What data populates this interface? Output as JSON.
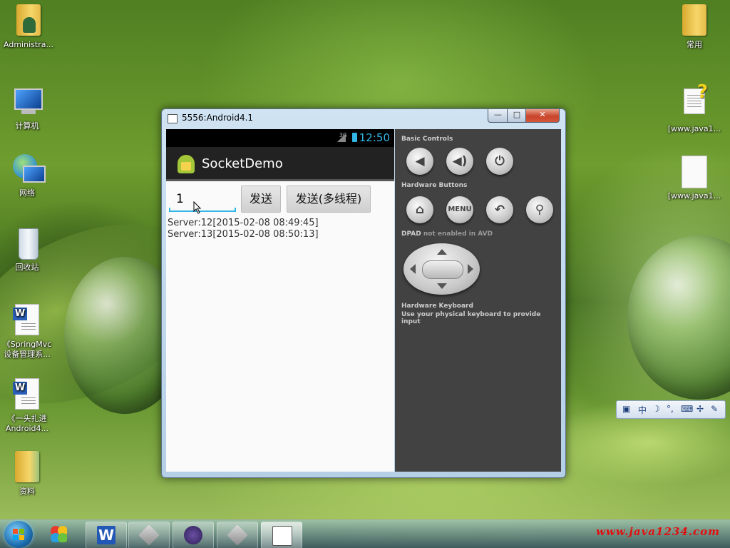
{
  "desktop": {
    "left_icons": [
      {
        "label": "Administra...",
        "icon": "user-folder-icon"
      },
      {
        "label": "计算机",
        "icon": "computer-icon"
      },
      {
        "label": "网络",
        "icon": "network-icon"
      },
      {
        "label": "回收站",
        "icon": "recycle-bin-icon"
      },
      {
        "label": "《SpringMvc\n设备管理系...",
        "icon": "word-document-icon"
      },
      {
        "label": "《一头扎进\nAndroid4...",
        "icon": "word-document-icon"
      },
      {
        "label": "资料",
        "icon": "folder-icon"
      }
    ],
    "right_icons": [
      {
        "label": "常用",
        "icon": "folder-icon"
      },
      {
        "label": "[www.java1...",
        "icon": "help-file-icon"
      },
      {
        "label": "[www.java1...",
        "icon": "blank-file-icon"
      }
    ]
  },
  "emulator": {
    "title": "5556:Android4.1",
    "window_buttons": {
      "minimize": "—",
      "maximize": "□",
      "close": "✕"
    },
    "statusbar": {
      "network": "3G",
      "clock": "12:50"
    },
    "app": {
      "title": "SocketDemo",
      "input_value": "1",
      "send_label": "发送",
      "send_multithread_label": "发送(多线程)",
      "messages": [
        "Server:12[2015-02-08 08:49:45]",
        "Server:13[2015-02-08 08:50:13]"
      ]
    },
    "controls": {
      "basic_controls_label": "Basic Controls",
      "hardware_buttons_label": "Hardware Buttons",
      "menu_label": "MENU",
      "dpad_label": "DPAD",
      "dpad_note": "not enabled in AVD",
      "keyboard_label": "Hardware Keyboard",
      "keyboard_note": "Use your physical keyboard to provide input"
    }
  },
  "ime_toolbar": {
    "lang": "中"
  },
  "taskbar": {
    "items": [
      "start-orb",
      "pinwheel-app",
      "wps-writer",
      "android-emulator",
      "java-ee-ide",
      "emulator-window",
      "notepad"
    ]
  },
  "watermark": "www.java1234.com",
  "colors": {
    "accent_holo": "#33b5e5",
    "controls_bg": "#424242",
    "watermark": "#e01010"
  }
}
